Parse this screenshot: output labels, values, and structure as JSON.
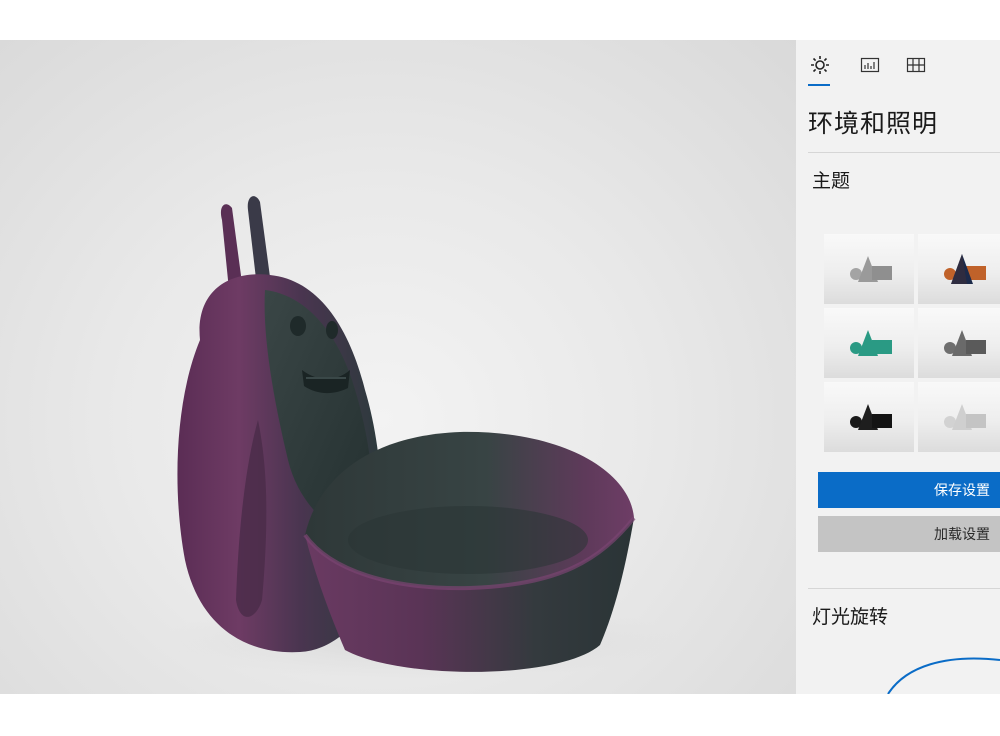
{
  "panel": {
    "tabs": [
      {
        "icon": "sun-icon",
        "active": true
      },
      {
        "icon": "chart-icon",
        "active": false
      },
      {
        "icon": "grid-icon",
        "active": false
      }
    ],
    "title": "环境和照明",
    "theme_section": "主题",
    "themes": [
      {
        "name": "light-gray-theme",
        "shapes": "#9a9a9a",
        "box": "#9a9a9a"
      },
      {
        "name": "warm-contrast-theme",
        "shapes": "#1c2a4a",
        "box": "#c0622a"
      },
      {
        "name": "teal-theme",
        "shapes": "#2a9a84",
        "box": "#2a9a84"
      },
      {
        "name": "dark-gray-theme",
        "shapes": "#6a6a6a",
        "box": "#5a5a5a"
      },
      {
        "name": "black-theme",
        "shapes": "#1a1a1a",
        "box": "#141414"
      },
      {
        "name": "white-theme",
        "shapes": "#cfcfcf",
        "box": "#c4c4c4"
      }
    ],
    "save_label": "保存设置",
    "load_label": "加载设置",
    "rotation_section": "灯光旋转"
  },
  "colors": {
    "accent": "#0a6cc7",
    "model_purple": "#6a3a62",
    "model_teal": "#2c3c3c"
  }
}
